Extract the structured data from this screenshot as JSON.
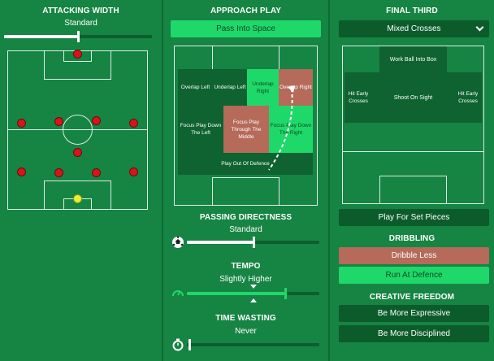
{
  "attacking_width": {
    "title": "ATTACKING WIDTH",
    "value": "Standard",
    "level": 0.52
  },
  "approach_play": {
    "title": "APPROACH PLAY",
    "button": "Pass Into Space",
    "zones": {
      "overlap_left": "Overlap Left",
      "underlap_left": "Underlap Left",
      "underlap_right": "Underlap Right",
      "overlap_right": "Overlap Right",
      "focus_left": "Focus Play Down The Left",
      "focus_middle": "Focus Play Through The Middle",
      "focus_right": "Focus Play Down The Right",
      "play_out": "Play Out Of Defence"
    }
  },
  "passing_directness": {
    "title": "PASSING DIRECTNESS",
    "value": "Standard",
    "level": 0.5,
    "icon": "ball-icon"
  },
  "tempo": {
    "title": "TEMPO",
    "value": "Slightly Higher",
    "level": 0.52,
    "range_max": 0.74,
    "icon": "speedometer-icon"
  },
  "time_wasting": {
    "title": "TIME WASTING",
    "value": "Never",
    "level": 0.02,
    "icon": "stopwatch-icon"
  },
  "final_third": {
    "title": "FINAL THIRD",
    "dropdown_value": "Mixed Crosses",
    "zones": {
      "work_ball": "Work Ball Into Box",
      "hit_early_left": "Hit Early Crosses",
      "shoot_on_sight": "Shoot On Sight",
      "hit_early_right": "Hit Early Crosses"
    },
    "set_pieces_button": "Play For Set Pieces"
  },
  "dribbling": {
    "title": "DRIBBLING",
    "less": "Dribble Less",
    "run_at": "Run At Defence"
  },
  "creative_freedom": {
    "title": "CREATIVE FREEDOM",
    "expressive": "Be More Expressive",
    "disciplined": "Be More Disciplined"
  },
  "colors": {
    "panel": "#168443",
    "accent_green": "#1fd86a",
    "dark_green": "#0c5c2b",
    "selected_red": "#b56a5a",
    "player": "#d8141b",
    "keeper": "#e6f23a"
  }
}
